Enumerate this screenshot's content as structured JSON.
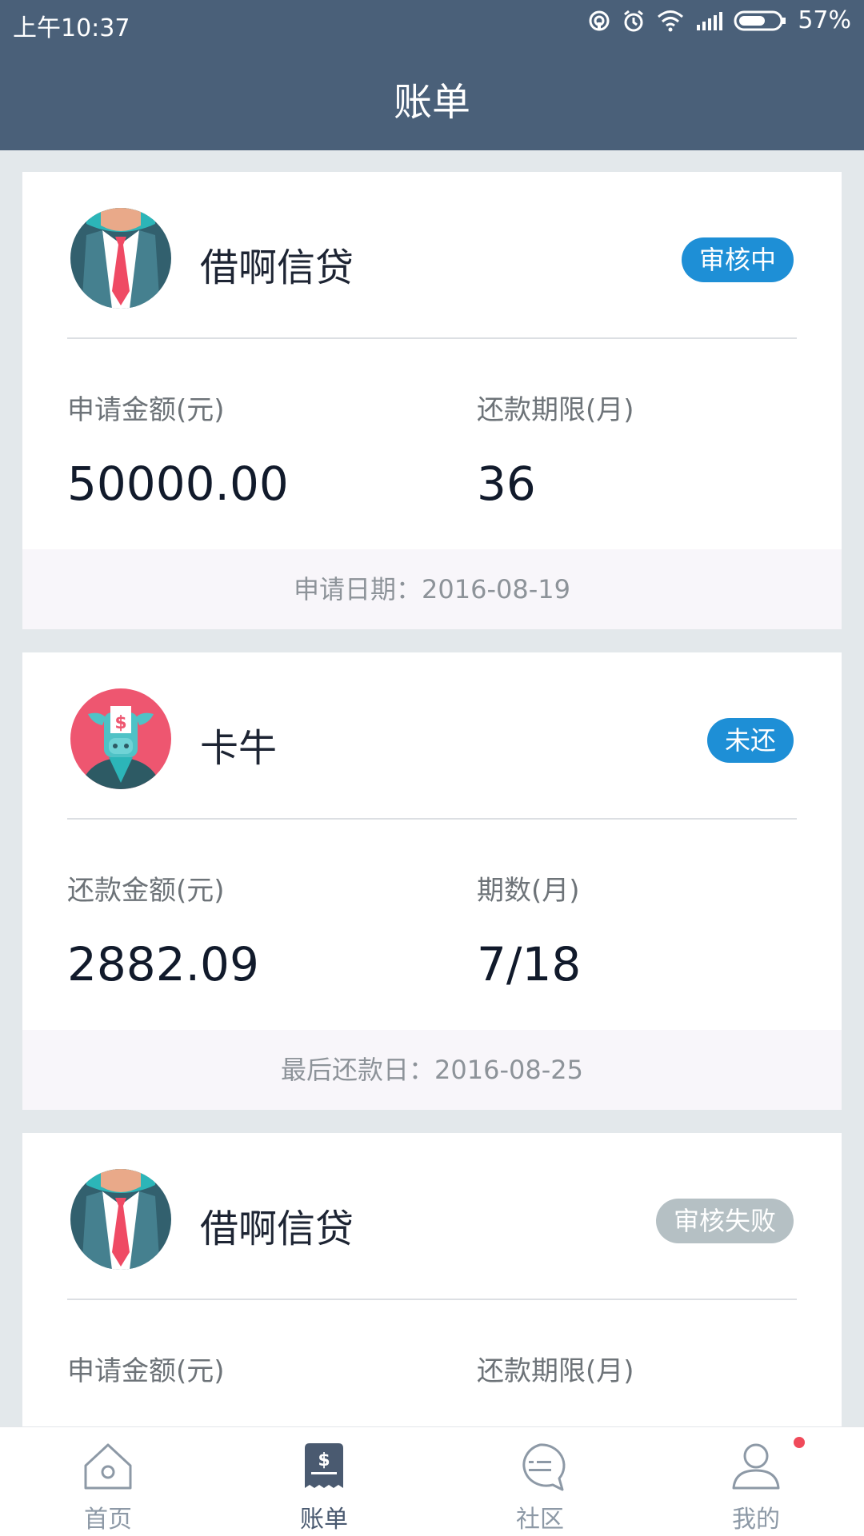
{
  "status_bar": {
    "time": "上午10:37",
    "battery": "57%"
  },
  "header": {
    "title": "账单"
  },
  "cards": [
    {
      "name": "借啊信贷",
      "status": "审核中",
      "label1": "申请金额(元)",
      "value1": "50000.00",
      "label2": "还款期限(月)",
      "value2": "36",
      "footer": "申请日期：2016-08-19"
    },
    {
      "name": "卡牛",
      "status": "未还",
      "label1": "还款金额(元)",
      "value1": "2882.09",
      "label2": "期数(月)",
      "value2": "7/18",
      "footer": "最后还款日：2016-08-25"
    },
    {
      "name": "借啊信贷",
      "status": "审核失败",
      "label1": "申请金额(元)",
      "label2": "还款期限(月)"
    }
  ],
  "nav": [
    {
      "label": "首页",
      "icon": "home-icon"
    },
    {
      "label": "账单",
      "icon": "bill-icon"
    },
    {
      "label": "社区",
      "icon": "community-icon"
    },
    {
      "label": "我的",
      "icon": "profile-icon"
    }
  ],
  "colors": {
    "header": "#4a6079",
    "badge_blue": "#1e8fd6",
    "badge_grey": "#b5c0c4",
    "notify_dot": "#f04a5a"
  }
}
